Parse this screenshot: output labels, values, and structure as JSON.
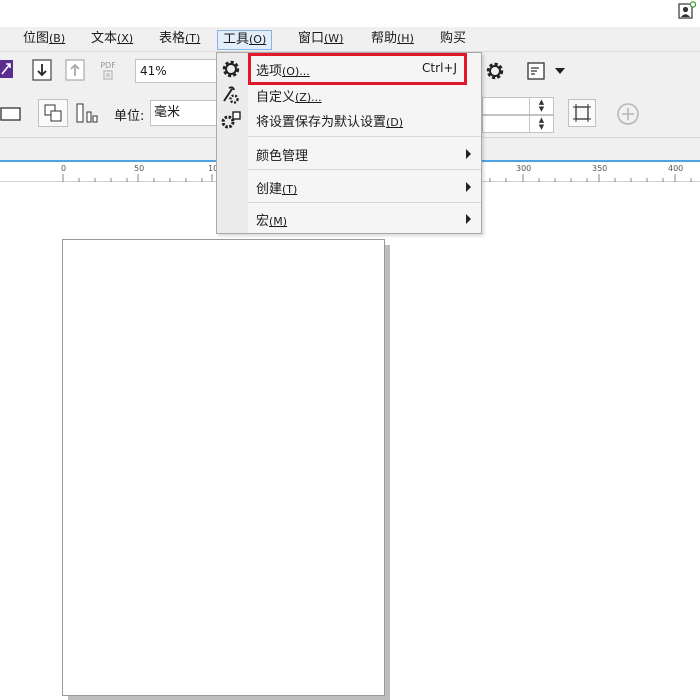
{
  "menubar": {
    "items": [
      {
        "label": "位图",
        "mnemonic": "(B)"
      },
      {
        "label": "文本",
        "mnemonic": "(X)"
      },
      {
        "label": "表格",
        "mnemonic": "(T)"
      },
      {
        "label": "工具",
        "mnemonic": "(O)"
      },
      {
        "label": "窗口",
        "mnemonic": "(W)"
      },
      {
        "label": "帮助",
        "mnemonic": "(H)"
      },
      {
        "label": "购买",
        "mnemonic": ""
      }
    ]
  },
  "toolbar": {
    "zoom_value": "41%",
    "pdf_label": "PDF",
    "unit_label": "单位:",
    "unit_value": "毫米"
  },
  "ruler": {
    "labels": [
      "0",
      "50",
      "10",
      "300",
      "350",
      "400"
    ]
  },
  "tools_menu": {
    "items": [
      {
        "label": "选项",
        "mnemonic": "(O)...",
        "shortcut": "Ctrl+J",
        "icon": "gear-icon"
      },
      {
        "label": "自定义",
        "mnemonic": "(Z)...",
        "shortcut": "",
        "icon": "wrench-gear-icon"
      },
      {
        "label": "将设置保存为默认设置",
        "mnemonic": "(D)",
        "shortcut": "",
        "icon": "gears-icon"
      },
      {
        "label": "颜色管理",
        "mnemonic": "",
        "shortcut": "",
        "icon": ""
      },
      {
        "label": "创建",
        "mnemonic": "(T)",
        "shortcut": "",
        "icon": ""
      },
      {
        "label": "宏",
        "mnemonic": "(M)",
        "shortcut": "",
        "icon": ""
      }
    ]
  },
  "colors": {
    "highlight": "#e0192a",
    "accent_blue": "#4fa3e0",
    "purple_icon": "#5c2d91"
  }
}
